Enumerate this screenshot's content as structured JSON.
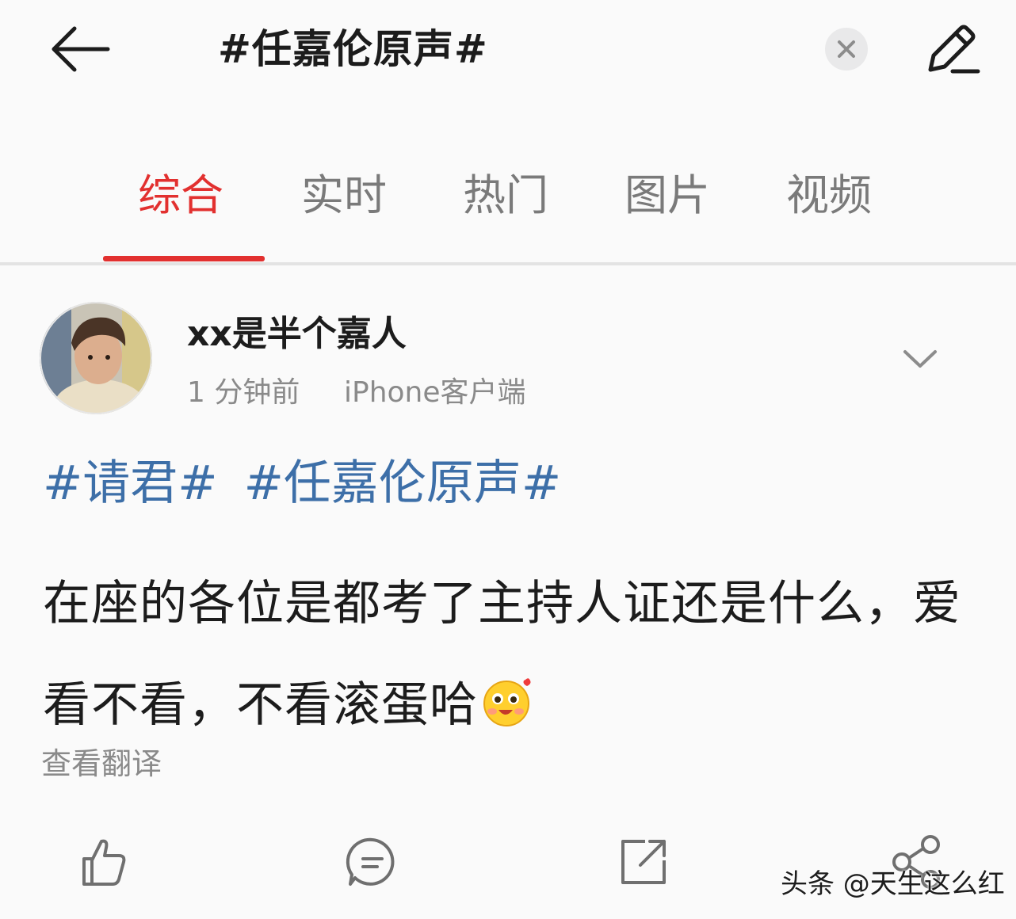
{
  "header": {
    "title": "#任嘉伦原声#"
  },
  "tabs": [
    {
      "label": "综合",
      "active": true
    },
    {
      "label": "实时",
      "active": false
    },
    {
      "label": "热门",
      "active": false
    },
    {
      "label": "图片",
      "active": false
    },
    {
      "label": "视频",
      "active": false
    }
  ],
  "post": {
    "username": "xx是半个嘉人",
    "time": "1 分钟前",
    "source": "iPhone客户端",
    "hashtags": [
      "#请君#",
      "#任嘉伦原声#"
    ],
    "text": "在座的各位是都考了主持人证还是什么，爱看不看，不看滚蛋哈",
    "translate_label": "查看翻译"
  },
  "actions": [
    "like-icon",
    "comment-icon",
    "repost-icon",
    "share-icon"
  ],
  "watermark": "头条 @天生这么红",
  "colors": {
    "accent": "#e2302f",
    "hashtag": "#3d6fa8",
    "muted": "#8a8a8a",
    "icon": "#6f6f6f"
  }
}
